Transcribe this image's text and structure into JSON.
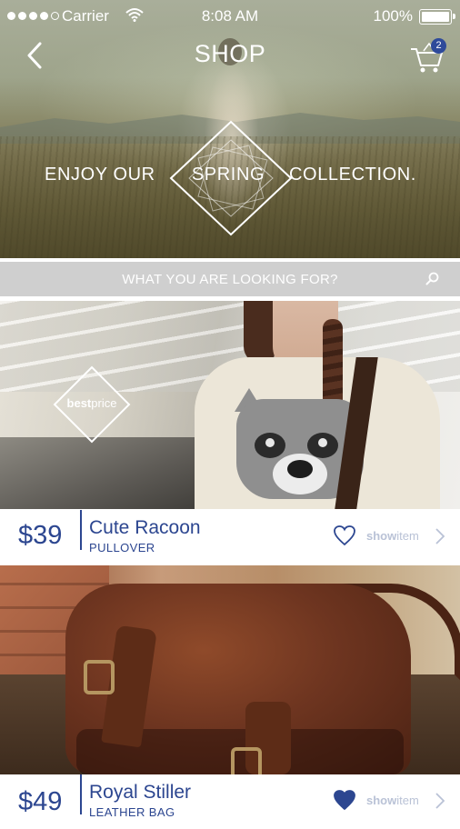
{
  "status_bar": {
    "carrier": "Carrier",
    "time": "8:08 AM",
    "battery": "100%"
  },
  "nav": {
    "title": "SHOP",
    "cart_count": "2"
  },
  "hero": {
    "promo_left": "ENJOY OUR",
    "promo_mid": "SPRING",
    "promo_right": "COLLECTION."
  },
  "search": {
    "placeholder": "WHAT YOU ARE LOOKING FOR?"
  },
  "products": [
    {
      "price": "$39",
      "name": "Cute Racoon",
      "category": "PULLOVER",
      "badge_bold": "best",
      "badge_rest": "price",
      "show_bold": "show",
      "show_rest": "item",
      "favorited": false
    },
    {
      "price": "$49",
      "name": "Royal Stiller",
      "category": "LEATHER BAG",
      "show_bold": "show",
      "show_rest": "item",
      "favorited": true
    }
  ],
  "colors": {
    "accent": "#2c4690",
    "search_bg": "#cfcfcf",
    "show_item": "#b9c2d6",
    "badge": "#2e4a9a"
  },
  "icons": [
    "signal-dots-icon",
    "wifi-icon",
    "battery-icon",
    "back-chevron-icon",
    "cart-icon",
    "search-icon",
    "heart-icon",
    "chevron-right-icon"
  ]
}
